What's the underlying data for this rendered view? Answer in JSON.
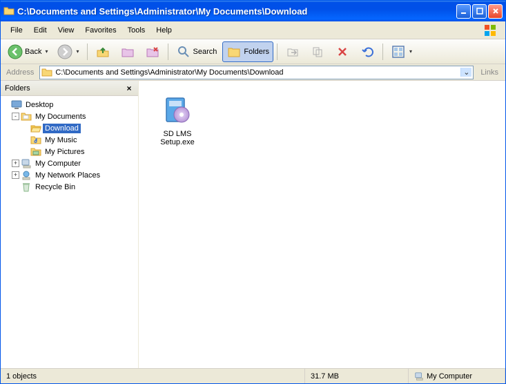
{
  "titlebar": {
    "title": "C:\\Documents and Settings\\Administrator\\My Documents\\Download"
  },
  "menu": {
    "file": "File",
    "edit": "Edit",
    "view": "View",
    "favorites": "Favorites",
    "tools": "Tools",
    "help": "Help"
  },
  "toolbar": {
    "back": "Back",
    "search": "Search",
    "folders": "Folders"
  },
  "address": {
    "label": "Address",
    "value": "C:\\Documents and Settings\\Administrator\\My Documents\\Download",
    "links": "Links"
  },
  "sidebar": {
    "title": "Folders",
    "tree": {
      "desktop": "Desktop",
      "mydocs": "My Documents",
      "download": "Download",
      "mymusic": "My Music",
      "mypictures": "My Pictures",
      "mycomputer": "My Computer",
      "mynetwork": "My Network Places",
      "recycle": "Recycle Bin"
    }
  },
  "files": {
    "item1": "SD LMS Setup.exe"
  },
  "status": {
    "objects": "1 objects",
    "size": "31.7 MB",
    "location": "My Computer"
  }
}
